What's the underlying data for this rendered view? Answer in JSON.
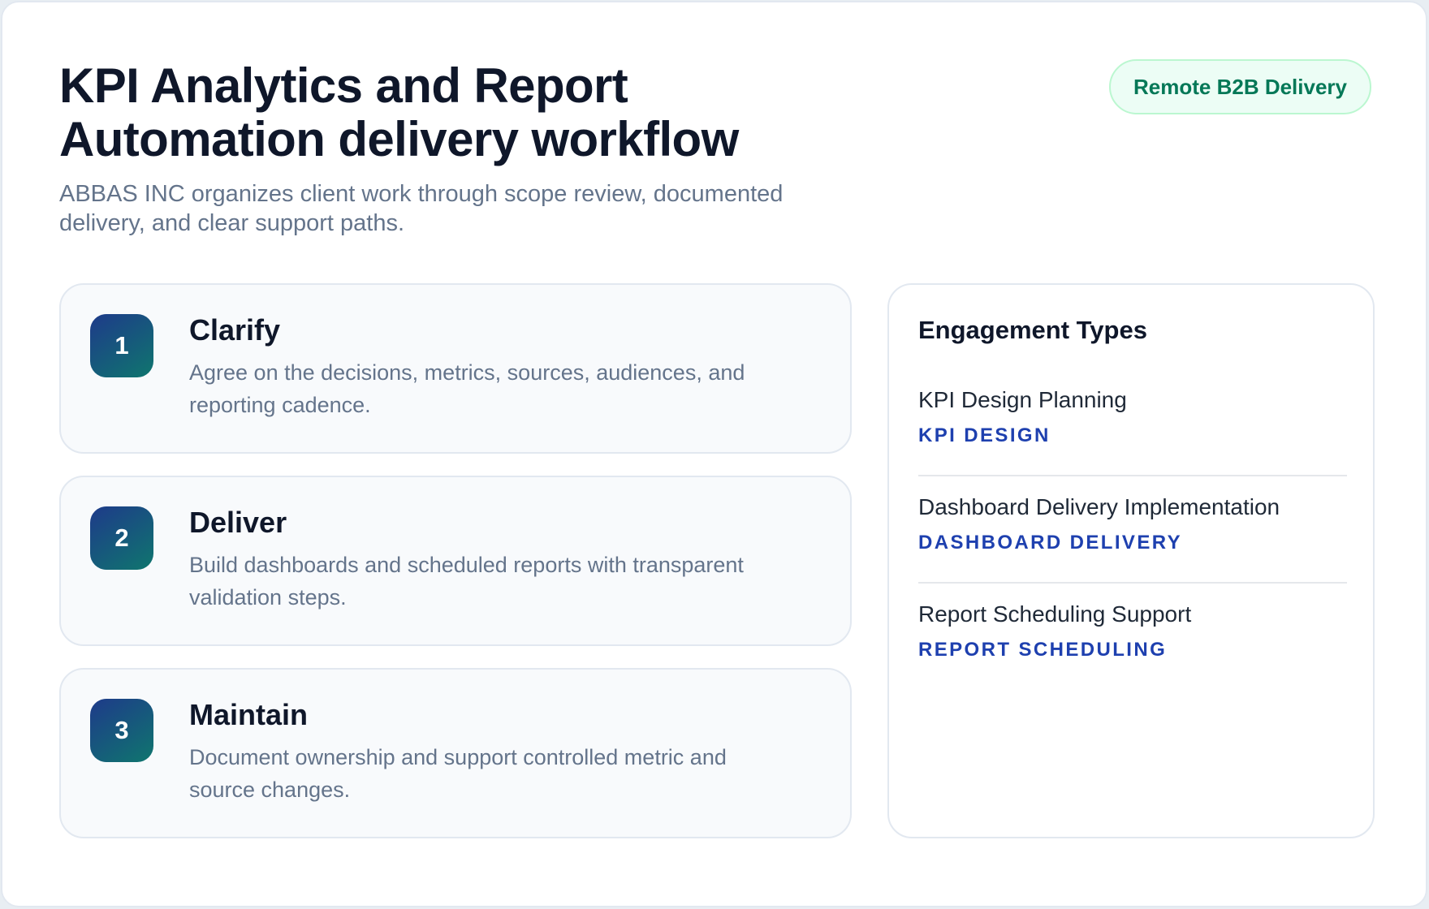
{
  "header": {
    "title_line_1": "KPI Analytics and Report",
    "title_line_2": "Automation delivery workflow",
    "subtitle_line_1": "ABBAS INC organizes client work through scope review, documented",
    "subtitle_line_2": "delivery, and clear support paths.",
    "badge": "Remote B2B Delivery"
  },
  "steps": [
    {
      "number": "1",
      "title": "Clarify",
      "description_line_1": "Agree on the decisions, metrics, sources, audiences, and",
      "description_line_2": "reporting cadence."
    },
    {
      "number": "2",
      "title": "Deliver",
      "description_line_1": "Build dashboards and scheduled reports with transparent",
      "description_line_2": "validation steps."
    },
    {
      "number": "3",
      "title": "Maintain",
      "description_line_1": "Document ownership and support controlled metric and",
      "description_line_2": "source changes."
    }
  ],
  "engagement": {
    "heading": "Engagement Types",
    "items": [
      {
        "name": "KPI Design Planning",
        "tag": "KPI DESIGN"
      },
      {
        "name": "Dashboard Delivery Implementation",
        "tag": "DASHBOARD DELIVERY"
      },
      {
        "name": "Report Scheduling Support",
        "tag": "REPORT SCHEDULING"
      }
    ]
  },
  "colors": {
    "title": "#0f172a",
    "muted_text": "#64748b",
    "badge_text": "#047857",
    "badge_background": "#ecfdf5",
    "tag_text": "#1e40af",
    "number_gradient_start": "#1e3a8a",
    "number_gradient_end": "#0f766e"
  }
}
